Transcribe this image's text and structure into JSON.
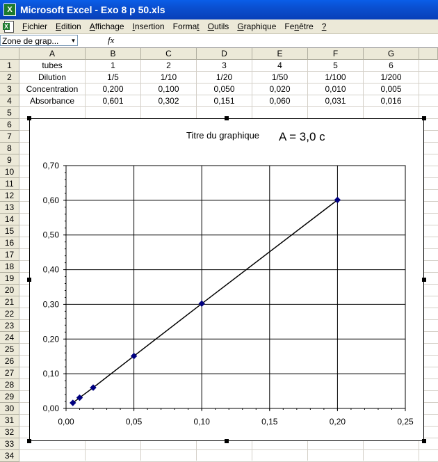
{
  "window": {
    "title": "Microsoft Excel - Exo 8 p 50.xls"
  },
  "menu": [
    {
      "label": "Fichier",
      "u": "F"
    },
    {
      "label": "Edition",
      "u": "E"
    },
    {
      "label": "Affichage",
      "u": "A"
    },
    {
      "label": "Insertion",
      "u": "I"
    },
    {
      "label": "Format",
      "u": "t"
    },
    {
      "label": "Outils",
      "u": "O"
    },
    {
      "label": "Graphique",
      "u": "G"
    },
    {
      "label": "Fenêtre",
      "u": "n"
    },
    {
      "label": "?",
      "u": "?"
    }
  ],
  "formula_bar": {
    "name_box": "Zone de grap...",
    "fx": "fx",
    "formula": ""
  },
  "columns": [
    "A",
    "B",
    "C",
    "D",
    "E",
    "F",
    "G"
  ],
  "rows": [
    "1",
    "2",
    "3",
    "4",
    "5",
    "6",
    "7",
    "8",
    "9",
    "10",
    "11",
    "12",
    "13",
    "14",
    "15",
    "16",
    "17",
    "18",
    "19",
    "20",
    "21",
    "22",
    "23",
    "24",
    "25",
    "26",
    "27",
    "28",
    "29",
    "30",
    "31",
    "32",
    "33",
    "34"
  ],
  "table": [
    [
      "tubes",
      "1",
      "2",
      "3",
      "4",
      "5",
      "6"
    ],
    [
      "Dilution",
      "1/5",
      "1/10",
      "1/20",
      "1/50",
      "1/100",
      "1/200"
    ],
    [
      "Concentration",
      "0,200",
      "0,100",
      "0,050",
      "0,020",
      "0,010",
      "0,005"
    ],
    [
      "Absorbance",
      "0,601",
      "0,302",
      "0,151",
      "0,060",
      "0,031",
      "0,016"
    ]
  ],
  "chart_data": {
    "type": "scatter",
    "title": "Titre du graphique",
    "annotation": "A = 3,0 c",
    "xlabel": "",
    "ylabel": "",
    "xlim": [
      0,
      0.25
    ],
    "ylim": [
      0,
      0.7
    ],
    "x_ticks": [
      "0,00",
      "0,05",
      "0,10",
      "0,15",
      "0,20",
      "0,25"
    ],
    "y_ticks": [
      "0,00",
      "0,10",
      "0,20",
      "0,30",
      "0,40",
      "0,50",
      "0,60",
      "0,70"
    ],
    "grid": true,
    "legend": "none",
    "series": [
      {
        "x": [
          0.2,
          0.1,
          0.05,
          0.02,
          0.01,
          0.005
        ],
        "y": [
          0.601,
          0.302,
          0.151,
          0.06,
          0.031,
          0.016
        ],
        "color": "#000080",
        "line": true
      }
    ]
  },
  "colors": {
    "titlebar": "#0a55df",
    "chrome": "#ece9d8",
    "grid": "#d4d0c8",
    "marker": "#000080"
  }
}
